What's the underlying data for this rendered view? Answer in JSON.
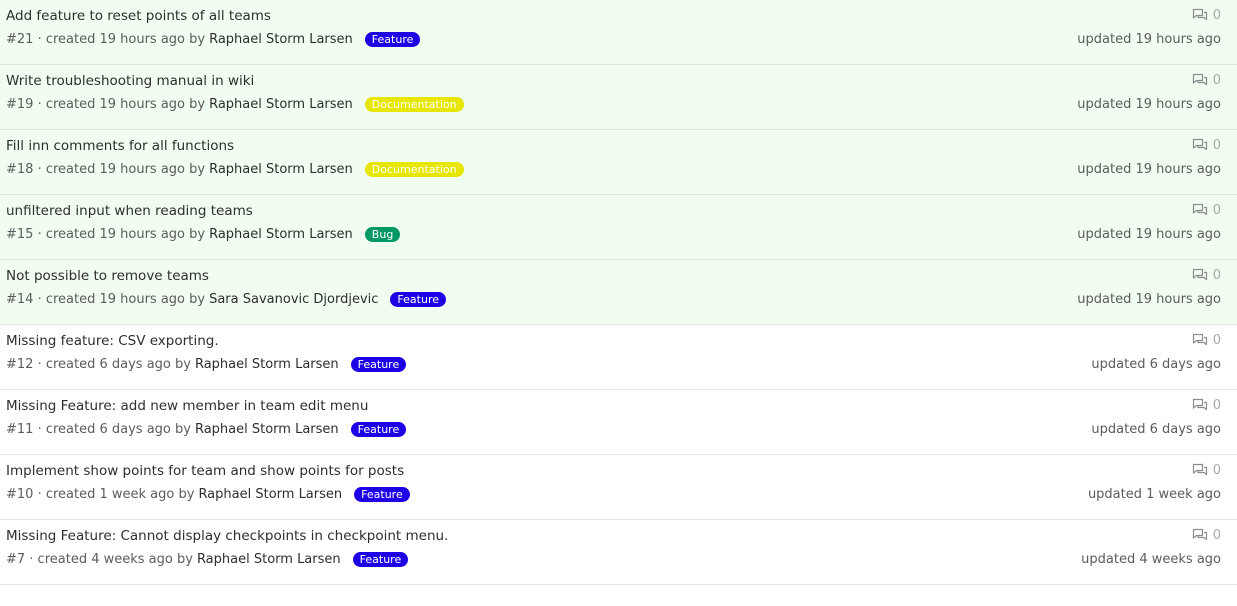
{
  "colors": {
    "feature": "#1e00e6",
    "documentation": "#e6e600",
    "bug": "#009966",
    "new_row_bg": "#f1fdf0"
  },
  "issues": [
    {
      "title": "Add feature to reset points of all teams",
      "meta": "#21 · created 19 hours ago by",
      "author": "Raphael Storm Larsen",
      "label": "Feature",
      "label_color": "#1e00e6",
      "comments": "0",
      "updated": "updated 19 hours ago",
      "highlight": true
    },
    {
      "title": "Write troubleshooting manual in wiki",
      "meta": "#19 · created 19 hours ago by",
      "author": "Raphael Storm Larsen",
      "label": "Documentation",
      "label_color": "#e6e600",
      "comments": "0",
      "updated": "updated 19 hours ago",
      "highlight": true
    },
    {
      "title": "Fill inn comments for all functions",
      "meta": "#18 · created 19 hours ago by",
      "author": "Raphael Storm Larsen",
      "label": "Documentation",
      "label_color": "#e6e600",
      "comments": "0",
      "updated": "updated 19 hours ago",
      "highlight": true
    },
    {
      "title": "unfiltered input when reading teams",
      "meta": "#15 · created 19 hours ago by",
      "author": "Raphael Storm Larsen",
      "label": "Bug",
      "label_color": "#009966",
      "comments": "0",
      "updated": "updated 19 hours ago",
      "highlight": true
    },
    {
      "title": "Not possible to remove teams",
      "meta": "#14 · created 19 hours ago by",
      "author": "Sara Savanovic Djordjevic",
      "label": "Feature",
      "label_color": "#1e00e6",
      "comments": "0",
      "updated": "updated 19 hours ago",
      "highlight": true
    },
    {
      "title": "Missing feature: CSV exporting.",
      "meta": "#12 · created 6 days ago by",
      "author": "Raphael Storm Larsen",
      "label": "Feature",
      "label_color": "#1e00e6",
      "comments": "0",
      "updated": "updated 6 days ago",
      "highlight": false
    },
    {
      "title": "Missing Feature: add new member in team edit menu",
      "meta": "#11 · created 6 days ago by",
      "author": "Raphael Storm Larsen",
      "label": "Feature",
      "label_color": "#1e00e6",
      "comments": "0",
      "updated": "updated 6 days ago",
      "highlight": false
    },
    {
      "title": "Implement show points for team and show points for posts",
      "meta": "#10 · created 1 week ago by",
      "author": "Raphael Storm Larsen",
      "label": "Feature",
      "label_color": "#1e00e6",
      "comments": "0",
      "updated": "updated 1 week ago",
      "highlight": false
    },
    {
      "title": "Missing Feature: Cannot display checkpoints in checkpoint menu.",
      "meta": "#7 · created 4 weeks ago by",
      "author": "Raphael Storm Larsen",
      "label": "Feature",
      "label_color": "#1e00e6",
      "comments": "0",
      "updated": "updated 4 weeks ago",
      "highlight": false
    }
  ]
}
